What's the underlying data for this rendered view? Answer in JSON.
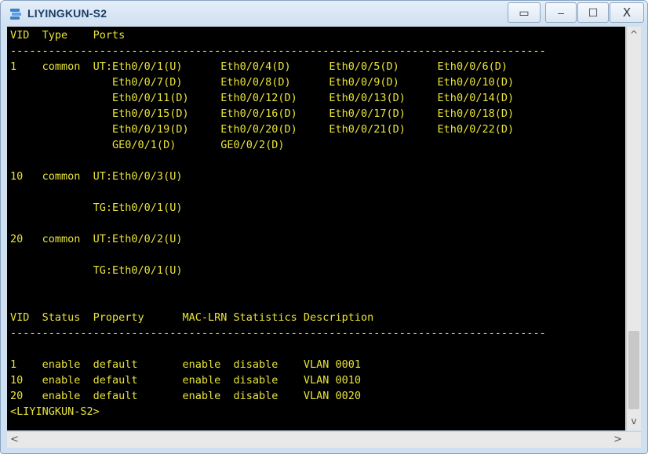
{
  "window": {
    "title": "LIYINGKUN-S2",
    "buttons": {
      "extra": "▭",
      "minimize": "–",
      "maximize": "☐",
      "close": "X"
    }
  },
  "terminal": {
    "lines": [
      "VID  Type    Ports",
      "------------------------------------------------------------------------------------",
      "1    common  UT:Eth0/0/1(U)      Eth0/0/4(D)      Eth0/0/5(D)      Eth0/0/6(D)",
      "                Eth0/0/7(D)      Eth0/0/8(D)      Eth0/0/9(D)      Eth0/0/10(D)",
      "                Eth0/0/11(D)     Eth0/0/12(D)     Eth0/0/13(D)     Eth0/0/14(D)",
      "                Eth0/0/15(D)     Eth0/0/16(D)     Eth0/0/17(D)     Eth0/0/18(D)",
      "                Eth0/0/19(D)     Eth0/0/20(D)     Eth0/0/21(D)     Eth0/0/22(D)",
      "                GE0/0/1(D)       GE0/0/2(D)",
      "",
      "10   common  UT:Eth0/0/3(U)",
      "",
      "             TG:Eth0/0/1(U)",
      "",
      "20   common  UT:Eth0/0/2(U)",
      "",
      "             TG:Eth0/0/1(U)",
      "",
      "",
      "VID  Status  Property      MAC-LRN Statistics Description",
      "------------------------------------------------------------------------------------",
      "",
      "1    enable  default       enable  disable    VLAN 0001",
      "10   enable  default       enable  disable    VLAN 0010",
      "20   enable  default       enable  disable    VLAN 0020",
      "<LIYINGKUN-S2>"
    ]
  },
  "scrollbars": {
    "up": "^",
    "down": "v",
    "left": "<",
    "right": ">"
  },
  "colors": {
    "terminal_bg": "#000000",
    "terminal_text": "#e8e33a",
    "title_text": "#1e3d66"
  }
}
